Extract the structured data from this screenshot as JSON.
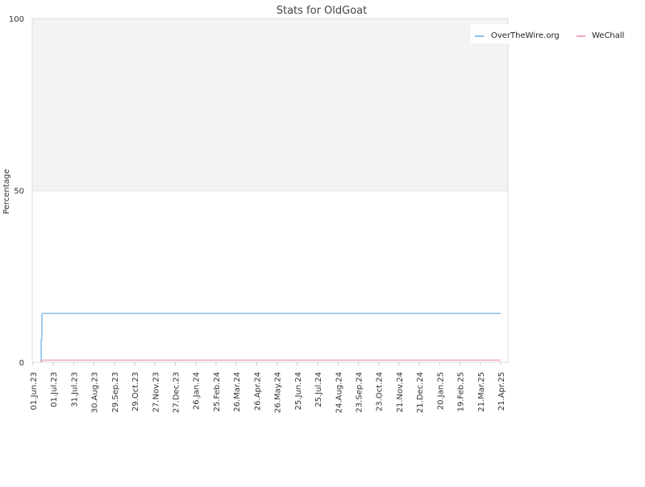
{
  "chart_data": {
    "type": "line",
    "title": "Stats for OldGoat",
    "xlabel": "",
    "ylabel": "Percentage",
    "ylim": [
      0,
      100
    ],
    "yticks": [
      0,
      50,
      100
    ],
    "grid": true,
    "legend_position": "top-right",
    "x_axis": {
      "type": "date",
      "start": "2023-06-01",
      "end": "2025-04-21",
      "tick_labels": [
        "01.Jun.23",
        "01.Jul.23",
        "31.Jul.23",
        "30.Aug.23",
        "29.Sep.23",
        "29.Oct.23",
        "27.Nov.23",
        "27.Dec.23",
        "26.Jan.24",
        "25.Feb.24",
        "26.Mar.24",
        "26.Apr.24",
        "26.May.24",
        "25.Jun.24",
        "25.Jul.24",
        "24.Aug.24",
        "23.Sep.24",
        "23.Oct.24",
        "21.Nov.24",
        "21.Dec.24",
        "20.Jan.25",
        "19.Feb.25",
        "21.Mar.25",
        "21.Apr.25"
      ]
    },
    "series": [
      {
        "name": "OverTheWire.org",
        "color": "#87c0ee",
        "points": [
          {
            "x": "2023-06-13",
            "y": 0
          },
          {
            "x": "2023-06-13",
            "y": 6.5
          },
          {
            "x": "2023-06-14",
            "y": 6.5
          },
          {
            "x": "2023-06-14",
            "y": 14
          },
          {
            "x": "2023-06-15",
            "y": 14.2
          },
          {
            "x": "2025-04-21",
            "y": 14.2
          }
        ]
      },
      {
        "name": "WeChall",
        "color": "#f4a9bd",
        "points": [
          {
            "x": "2023-06-13",
            "y": 0
          },
          {
            "x": "2023-06-15",
            "y": 0.6
          },
          {
            "x": "2025-04-21",
            "y": 0.6
          }
        ]
      }
    ]
  }
}
